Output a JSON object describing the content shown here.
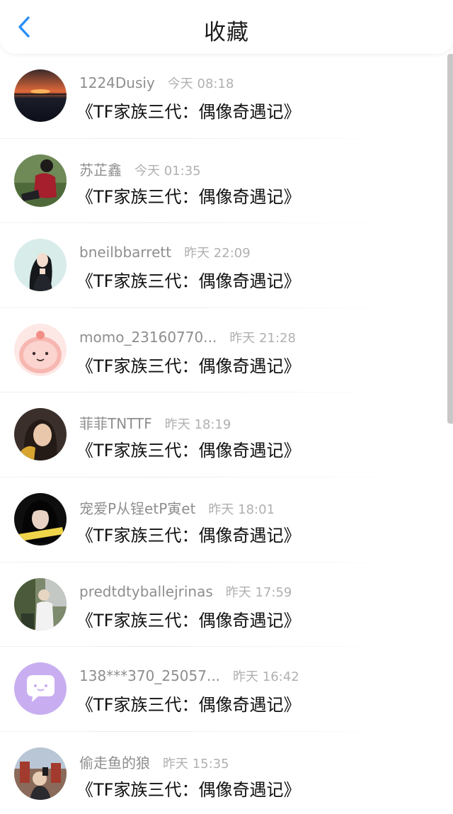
{
  "header": {
    "title": "收藏",
    "back_icon": "chevron-left-icon",
    "accent_color": "#2a8ff7"
  },
  "favorites": [
    {
      "username": "1224Dusiy",
      "time": "今天 08:18",
      "content": "《TF家族三代：偶像奇遇记》",
      "avatar_icon": "sunset-sea-avatar"
    },
    {
      "username": "苏芷鑫",
      "time": "今天 01:35",
      "content": "《TF家族三代：偶像奇遇记》",
      "avatar_icon": "girl-on-grass-avatar"
    },
    {
      "username": "bneilbbarrett",
      "time": "昨天 22:09",
      "content": "《TF家族三代：偶像奇遇记》",
      "avatar_icon": "illustrated-girl-avatar"
    },
    {
      "username": "momo_23160770...",
      "time": "昨天 21:28",
      "content": "《TF家族三代：偶像奇遇记》",
      "avatar_icon": "pink-blob-avatar"
    },
    {
      "username": "菲菲TNTTF",
      "time": "昨天 18:19",
      "content": "《TF家族三代：偶像奇遇记》",
      "avatar_icon": "girl-portrait-avatar"
    },
    {
      "username": "宠爱P从锃etP寅et",
      "time": "昨天 18:01",
      "content": "《TF家族三代：偶像奇遇记》",
      "avatar_icon": "dark-hair-girl-avatar"
    },
    {
      "username": "predtdtyballejrinas",
      "time": "昨天 17:59",
      "content": "《TF家族三代：偶像奇遇记》",
      "avatar_icon": "outdoor-person-avatar"
    },
    {
      "username": "138***370_25057...",
      "time": "昨天 16:42",
      "content": "《TF家族三代：偶像奇遇记》",
      "avatar_icon": "purple-chat-bubble-avatar"
    },
    {
      "username": "偷走鱼的狼",
      "time": "昨天 15:35",
      "content": "《TF家族三代：偶像奇遇记》",
      "avatar_icon": "city-selfie-avatar"
    }
  ]
}
